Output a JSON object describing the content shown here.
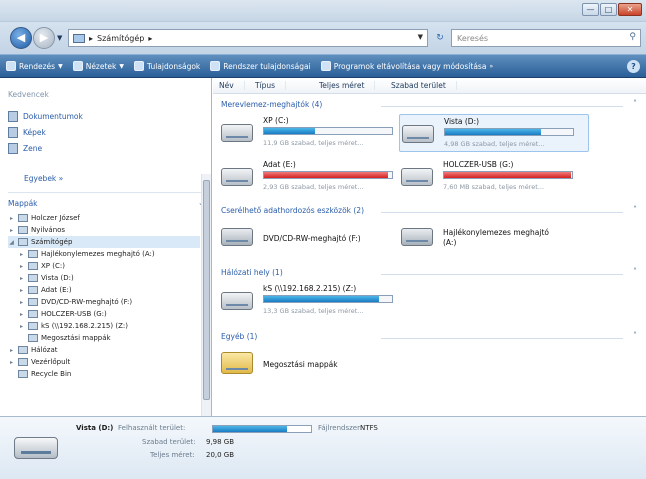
{
  "window": {
    "min": "—",
    "max": "□",
    "close": "✕"
  },
  "address": {
    "path": "Számítógép",
    "separator": "▸",
    "refresh": "↻",
    "search_placeholder": "Keresés"
  },
  "commands": [
    {
      "label": "Rendezés",
      "dropdown": true
    },
    {
      "label": "Nézetek",
      "dropdown": true
    },
    {
      "label": "Tulajdonságok",
      "dropdown": false
    },
    {
      "label": "Rendszer tulajdonságai",
      "dropdown": false
    },
    {
      "label": "Programok eltávolítása vagy módosítása",
      "dropdown": false
    }
  ],
  "nav": {
    "favorites_header": "Kedvencek",
    "favorites": [
      "Dokumentumok",
      "Képek",
      "Zene"
    ],
    "more": "Egyebek »",
    "folders_header": "Mappák",
    "tree": [
      {
        "label": "Holczer József",
        "level": 1,
        "expander": "▸",
        "selected": false
      },
      {
        "label": "Nyilvános",
        "level": 1,
        "expander": "▸",
        "selected": false
      },
      {
        "label": "Számítógép",
        "level": 1,
        "expander": "◢",
        "selected": true
      },
      {
        "label": "Hajlékonylemezes meghajtó (A:)",
        "level": 2,
        "expander": "▸",
        "selected": false
      },
      {
        "label": "XP (C:)",
        "level": 2,
        "expander": "▸",
        "selected": false
      },
      {
        "label": "Vista (D:)",
        "level": 2,
        "expander": "▸",
        "selected": false
      },
      {
        "label": "Adat (E:)",
        "level": 2,
        "expander": "▸",
        "selected": false
      },
      {
        "label": "DVD/CD-RW-meghajtó (F:)",
        "level": 2,
        "expander": "▸",
        "selected": false
      },
      {
        "label": "HOLCZER-USB (G:)",
        "level": 2,
        "expander": "▸",
        "selected": false
      },
      {
        "label": "kS (\\\\192.168.2.215) (Z:)",
        "level": 2,
        "expander": "▸",
        "selected": false
      },
      {
        "label": "Megosztási mappák",
        "level": 2,
        "expander": "",
        "selected": false
      },
      {
        "label": "Hálózat",
        "level": 1,
        "expander": "▸",
        "selected": false
      },
      {
        "label": "Vezérlőpult",
        "level": 1,
        "expander": "▸",
        "selected": false
      },
      {
        "label": "Recycle Bin",
        "level": 1,
        "expander": "",
        "selected": false
      }
    ]
  },
  "columns": [
    "Név",
    "Típus",
    "Teljes méret",
    "Szabad terület"
  ],
  "groups": {
    "hdd": "Merevlemez-meghajtók (4)",
    "removable": "Cserélhető adathordozós eszközök (2)",
    "network": "Hálózati hely (1)",
    "other": "Egyéb (1)"
  },
  "drives": [
    {
      "name": "XP (C:)",
      "sub": "11,9 GB szabad, teljes méret...",
      "fill": 0.4,
      "status": "normal"
    },
    {
      "name": "Vista (D:)",
      "sub": "4,98 GB szabad, teljes méret...",
      "fill": 0.75,
      "status": "normal"
    },
    {
      "name": "Adat (E:)",
      "sub": "2,93 GB szabad, teljes méret...",
      "fill": 0.97,
      "status": "low"
    },
    {
      "name": "HOLCZER-USB (G:)",
      "sub": "7,60 MB szabad, teljes méret...",
      "fill": 0.99,
      "status": "low"
    },
    {
      "name": "kS (\\\\192.168.2.215) (Z:)",
      "sub": "13,3 GB szabad, teljes méret...",
      "fill": 0.9,
      "status": "normal"
    }
  ],
  "removable": [
    {
      "name": "DVD/CD-RW-meghajtó (F:)"
    },
    {
      "name": "Hajlékonylemezes meghajtó (A:)"
    }
  ],
  "other": [
    {
      "name": "Megosztási mappák"
    }
  ],
  "details": {
    "drive_name": "Vista (D:)",
    "used_label": "Felhasznált terület:",
    "used_fill": 0.75,
    "fs_label": "Fájlrendszer:",
    "fs_value": "NTFS",
    "free_label": "Szabad terület:",
    "free_value": "9,98 GB",
    "total_label": "Teljes méret:",
    "total_value": "20,0 GB"
  }
}
